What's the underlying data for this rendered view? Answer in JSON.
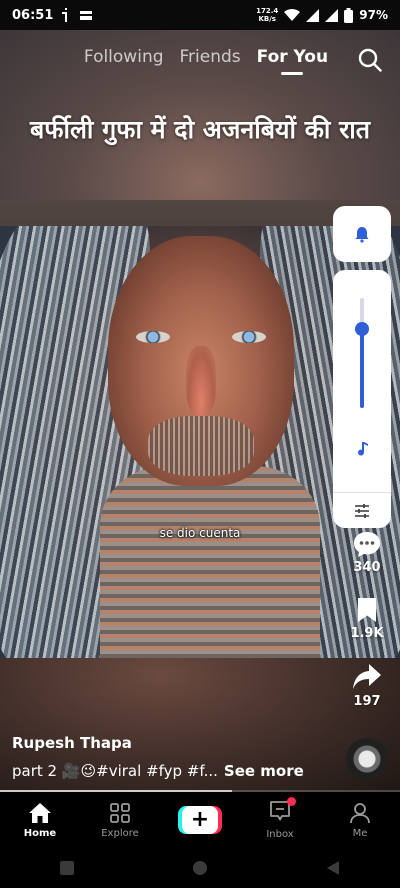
{
  "status_bar": {
    "time": "06:51",
    "net_speed_value": "172.4",
    "net_speed_unit": "KB/s",
    "battery": "97%"
  },
  "top_nav": {
    "tabs": [
      {
        "label": "Following",
        "active": false
      },
      {
        "label": "Friends",
        "active": false
      },
      {
        "label": "For You",
        "active": true
      }
    ],
    "search_icon": "search-icon"
  },
  "video": {
    "overlay_title": "बर्फीली गुफा में दो अजनबियों की रात",
    "caption": "se dio cuenta",
    "progress": 0.58
  },
  "volume_panel": {
    "bell_icon": "bell-icon",
    "music_icon": "music-note-icon",
    "tune_icon": "tune-icon",
    "level": 0.72,
    "accent": "#2f5fd6"
  },
  "actions": {
    "comments": {
      "icon": "comment-icon",
      "count": "340"
    },
    "bookmarks": {
      "icon": "bookmark-icon",
      "count": "1.9K"
    },
    "shares": {
      "icon": "share-icon",
      "count": "197"
    }
  },
  "post": {
    "author": "Rupesh Thapa",
    "description": "part 2 🎥😉#viral #fyp #f...",
    "see_more": "See more"
  },
  "bottom_nav": {
    "items": [
      {
        "label": "Home",
        "icon": "home-icon",
        "active": true
      },
      {
        "label": "Explore",
        "icon": "explore-icon",
        "active": false
      },
      {
        "label": "",
        "icon": "create-plus-icon",
        "active": false
      },
      {
        "label": "Inbox",
        "icon": "inbox-icon",
        "active": false
      },
      {
        "label": "Me",
        "icon": "profile-icon",
        "active": false
      }
    ]
  },
  "colors": {
    "brand_red": "#fe2c55",
    "brand_cyan": "#25f4ee"
  }
}
